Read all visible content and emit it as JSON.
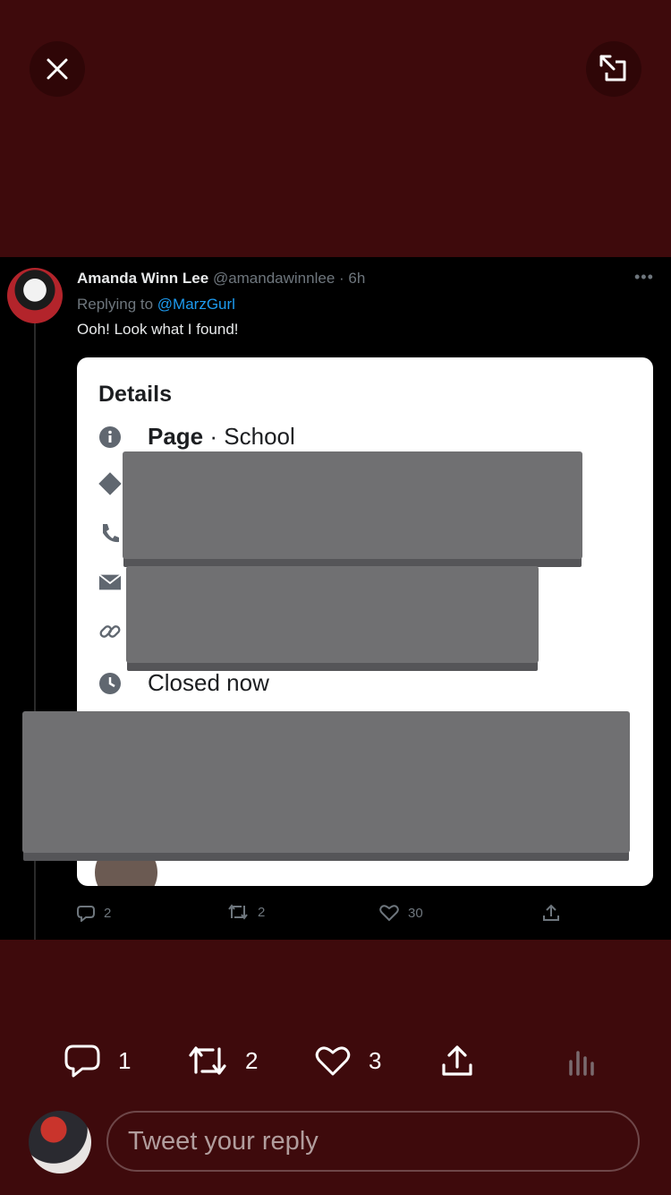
{
  "embedded_tweet": {
    "author_name": "Amanda Winn Lee",
    "author_handle": "@amandawinnlee · 6h",
    "replying_prefix": "Replying to ",
    "replying_to": "@MarzGurl",
    "text": "Ooh! Look what I found!",
    "card": {
      "title": "Details",
      "page_label": "Page",
      "page_value": " · School",
      "hours": "Closed now"
    },
    "stats": {
      "replies": "2",
      "retweets": "2",
      "likes": "30"
    }
  },
  "actions": {
    "replies": "1",
    "retweets": "2",
    "likes": "3"
  },
  "reply": {
    "placeholder": "Tweet your reply"
  },
  "colors": {
    "background": "#3e0a0c",
    "mention": "#1d9bf0"
  }
}
